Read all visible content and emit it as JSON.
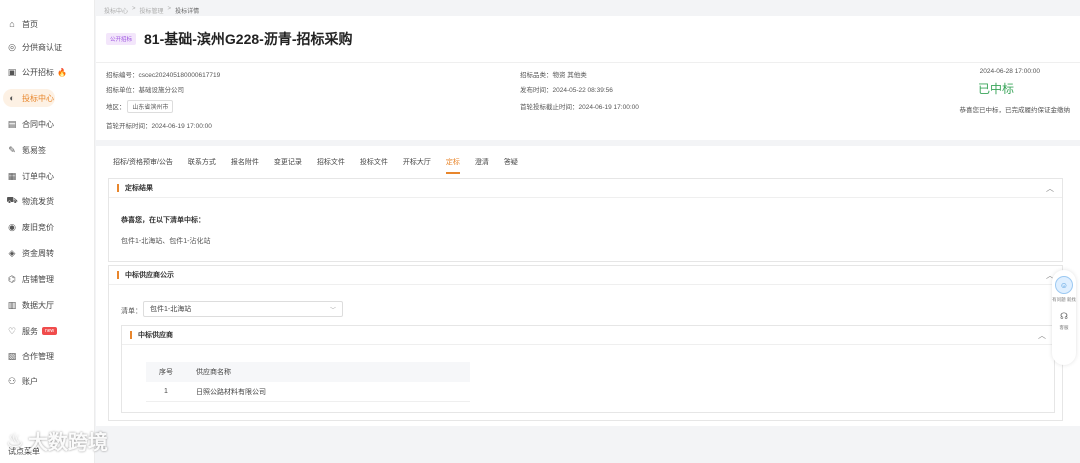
{
  "sidebar": {
    "items": [
      {
        "label": "首页",
        "icon": "home-icon",
        "glyph": "⌂"
      },
      {
        "label": "分供商认证",
        "icon": "certify-icon",
        "glyph": "◎"
      },
      {
        "label": "公开招标",
        "icon": "tender-icon",
        "glyph": "▣"
      },
      {
        "label": "投标中心",
        "icon": "bid-center-icon",
        "glyph": "◐"
      },
      {
        "label": "合同中心",
        "icon": "contract-icon",
        "glyph": "▤"
      },
      {
        "label": "氪易签",
        "icon": "sign-icon",
        "glyph": "✎"
      },
      {
        "label": "订单中心",
        "icon": "order-icon",
        "glyph": "▦"
      },
      {
        "label": "物流发货",
        "icon": "truck-icon",
        "glyph": "⛟"
      },
      {
        "label": "废旧竞价",
        "icon": "auction-icon",
        "glyph": "◉"
      },
      {
        "label": "资金周转",
        "icon": "fund-icon",
        "glyph": "◈"
      },
      {
        "label": "店铺管理",
        "icon": "shop-icon",
        "glyph": "⌬"
      },
      {
        "label": "数据大厅",
        "icon": "data-icon",
        "glyph": "▥"
      },
      {
        "label": "服务",
        "icon": "service-icon",
        "glyph": "♡"
      },
      {
        "label": "合作管理",
        "icon": "cooperation-icon",
        "glyph": "▧"
      },
      {
        "label": "账户",
        "icon": "user-icon",
        "glyph": "⚇"
      }
    ],
    "active_index": 3,
    "fire_glyph": "🔥",
    "new_badge": "new",
    "bottom_item": "试点菜单"
  },
  "breadcrumb": [
    "投标中心",
    "投标管理",
    "投标详情"
  ],
  "breadcrumb_sep": ">",
  "header": {
    "tag": "公开招标",
    "title": "81-基础-滨州G228-沥青-招标采购"
  },
  "meta": {
    "tender_no": "招标编号：cscec202405180000617719",
    "tender_unit": "招标单位：基础设施分公司",
    "region_label": "地区：",
    "region_value": "山东省滨州市",
    "first_open": "首轮开标时间：2024-06-19 17:00:00",
    "category": "招标品类：物资 其他类",
    "publish_time": "发布时间：2024-05-22 08:39:56",
    "deadline": "首轮投标截止时间：2024-06-19 17:00:00",
    "award_date": "2024-06-28 17:00:00",
    "award_status": "已中标",
    "award_note": "恭喜您已中标，已完成履约保证金缴纳"
  },
  "tabs": [
    "招标/资格预审/公告",
    "联系方式",
    "报名附件",
    "变更记录",
    "招标文件",
    "投标文件",
    "开标大厅",
    "定标",
    "澄清",
    "答疑"
  ],
  "active_tab": 7,
  "panel1": {
    "title": "定标结果",
    "congrats": "恭喜您，在以下清单中标：",
    "packages": "包件1-北海站、包件1-沾化站"
  },
  "panel2": {
    "title": "中标供应商公示",
    "list_label": "清单：",
    "selected": "包件1-北海站",
    "sub_title": "中标供应商",
    "table": {
      "headers": [
        "序号",
        "供应商名称"
      ],
      "rows": [
        [
          "1",
          "日照公路材料有限公司"
        ]
      ]
    }
  },
  "float_widget": {
    "text": "有问题 就找",
    "help_text": "客服"
  },
  "watermark": "大数跨境",
  "colors": {
    "accent": "#e8862c",
    "success": "#3aa55a",
    "tag": "#9b51e0"
  }
}
